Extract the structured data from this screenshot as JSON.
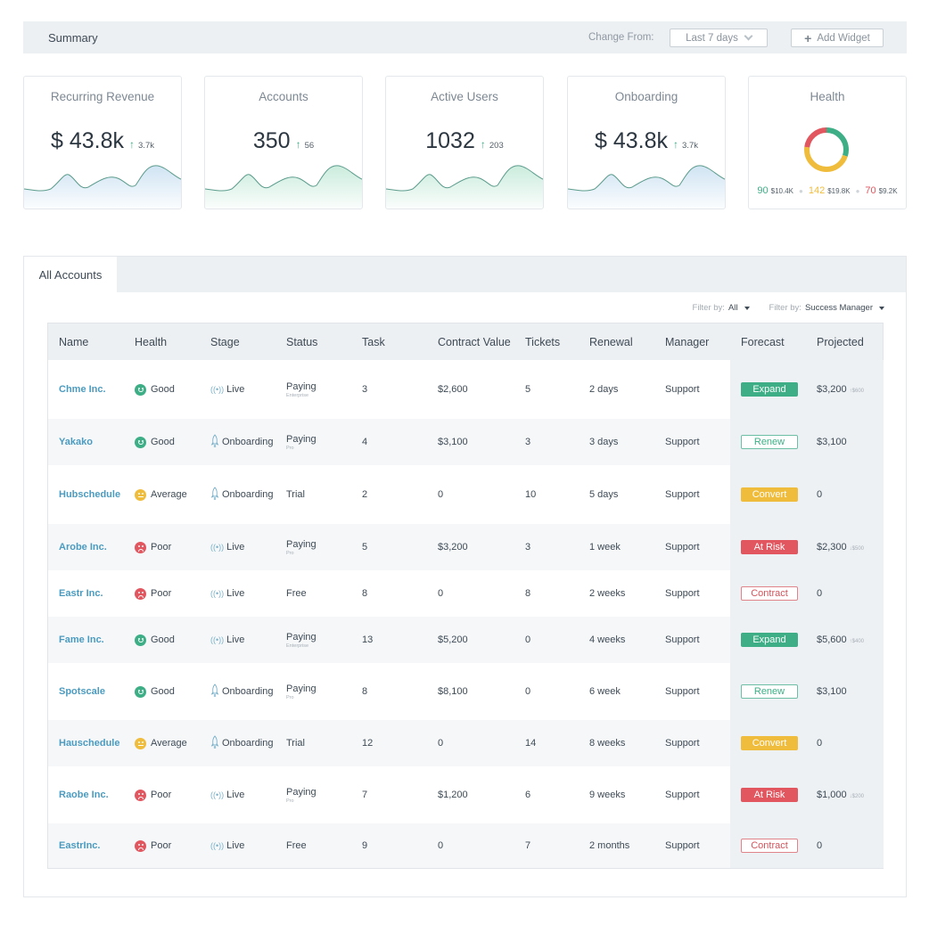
{
  "header": {
    "title": "Summary",
    "change_from_label": "Change From:",
    "date_range": "Last 7 days",
    "add_widget": "Add Widget"
  },
  "kpis": [
    {
      "title": "Recurring Revenue",
      "value": "$ 43.8k",
      "delta": "3.7k",
      "trend": "up",
      "color": "#a9cde9"
    },
    {
      "title": "Accounts",
      "value": "350",
      "delta": "56",
      "trend": "up",
      "color": "#9fdcc1"
    },
    {
      "title": "Active Users",
      "value": "1032",
      "delta": "203",
      "trend": "up",
      "color": "#9fdcc1"
    },
    {
      "title": "Onboarding",
      "value": "$ 43.8k",
      "delta": "3.7k",
      "trend": "up",
      "color": "#a9cde9"
    }
  ],
  "health_widget": {
    "title": "Health",
    "segments": [
      {
        "label": "Good",
        "count": "90",
        "amount": "$10.4K",
        "color": "#3dae86",
        "share": 0.3
      },
      {
        "label": "Average",
        "count": "142",
        "amount": "$19.8K",
        "color": "#f0bc3c",
        "share": 0.47
      },
      {
        "label": "Poor",
        "count": "70",
        "amount": "$9.2K",
        "color": "#e1565f",
        "share": 0.23
      }
    ]
  },
  "accounts": {
    "tab": "All Accounts",
    "filters": [
      {
        "label": "Filter by:",
        "value": "All"
      },
      {
        "label": "Filter by:",
        "value": "Success Manager"
      }
    ],
    "columns": [
      "Name",
      "Health",
      "Stage",
      "Status",
      "Task",
      "Contract Value",
      "Tickets",
      "Renewal",
      "Manager",
      "Forecast",
      "Projected"
    ],
    "rows": [
      {
        "name": "Chme Inc.",
        "health": "Good",
        "stage": "Live",
        "status": "Paying",
        "status_sub": "Enterprise",
        "task": "3",
        "contract_value": "$2,600",
        "tickets": "5",
        "renewal": "2 days",
        "manager": "Support",
        "forecast": "Expand",
        "projected": "$3,200",
        "projected_delta": "↑$600"
      },
      {
        "name": "Yakako",
        "health": "Good",
        "stage": "Onboarding",
        "status": "Paying",
        "status_sub": "Pro",
        "task": "4",
        "contract_value": "$3,100",
        "tickets": "3",
        "renewal": "3 days",
        "manager": "Support",
        "forecast": "Renew",
        "projected": "$3,100",
        "projected_delta": ""
      },
      {
        "name": "Hubschedule",
        "health": "Average",
        "stage": "Onboarding",
        "status": "Trial",
        "status_sub": "",
        "task": "2",
        "contract_value": "0",
        "tickets": "10",
        "renewal": "5 days",
        "manager": "Support",
        "forecast": "Convert",
        "projected": "0",
        "projected_delta": ""
      },
      {
        "name": "Arobe Inc.",
        "health": "Poor",
        "stage": "Live",
        "status": "Paying",
        "status_sub": "Pro",
        "task": "5",
        "contract_value": "$3,200",
        "tickets": "3",
        "renewal": "1 week",
        "manager": "Support",
        "forecast": "At Risk",
        "projected": "$2,300",
        "projected_delta": "↓$500"
      },
      {
        "name": "Eastr Inc.",
        "health": "Poor",
        "stage": "Live",
        "status": "Free",
        "status_sub": "",
        "task": "8",
        "contract_value": "0",
        "tickets": "8",
        "renewal": "2 weeks",
        "manager": "Support",
        "forecast": "Contract",
        "projected": "0",
        "projected_delta": ""
      },
      {
        "name": "Fame Inc.",
        "health": "Good",
        "stage": "Live",
        "status": "Paying",
        "status_sub": "Enterprise",
        "task": "13",
        "contract_value": "$5,200",
        "tickets": "0",
        "renewal": "4 weeks",
        "manager": "Support",
        "forecast": "Expand",
        "projected": "$5,600",
        "projected_delta": "↑$400"
      },
      {
        "name": "Spotscale",
        "health": "Good",
        "stage": "Onboarding",
        "status": "Paying",
        "status_sub": "Pro",
        "task": "8",
        "contract_value": "$8,100",
        "tickets": "0",
        "renewal": "6 week",
        "manager": "Support",
        "forecast": "Renew",
        "projected": "$3,100",
        "projected_delta": ""
      },
      {
        "name": "Hauschedule",
        "health": "Average",
        "stage": "Onboarding",
        "status": "Trial",
        "status_sub": "",
        "task": "12",
        "contract_value": "0",
        "tickets": "14",
        "renewal": "8 weeks",
        "manager": "Support",
        "forecast": "Convert",
        "projected": "0",
        "projected_delta": ""
      },
      {
        "name": "Raobe Inc.",
        "health": "Poor",
        "stage": "Live",
        "status": "Paying",
        "status_sub": "Pro",
        "task": "7",
        "contract_value": "$1,200",
        "tickets": "6",
        "renewal": "9 weeks",
        "manager": "Support",
        "forecast": "At Risk",
        "projected": "$1,000",
        "projected_delta": "↓$200"
      },
      {
        "name": "EastrInc.",
        "health": "Poor",
        "stage": "Live",
        "status": "Free",
        "status_sub": "",
        "task": "9",
        "contract_value": "0",
        "tickets": "7",
        "renewal": "2 months",
        "manager": "Support",
        "forecast": "Contract",
        "projected": "0",
        "projected_delta": ""
      }
    ]
  },
  "colors": {
    "good": "#3dae86",
    "average": "#f0bc3c",
    "poor": "#e1565f",
    "link": "#4b9bc0"
  }
}
